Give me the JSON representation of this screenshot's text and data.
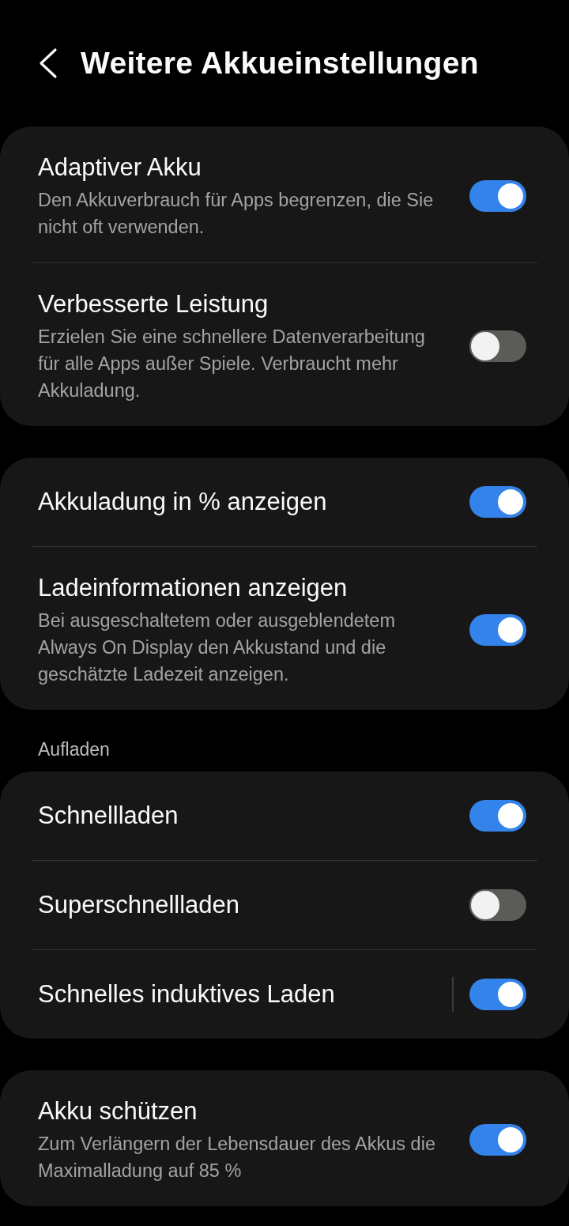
{
  "header": {
    "title": "Weitere Akkueinstellungen"
  },
  "groups": [
    {
      "items": [
        {
          "kind": "switch",
          "title": "Adaptiver Akku",
          "subtitle": "Den Akkuverbrauch für Apps begrenzen, die Sie nicht oft verwenden.",
          "on": true
        },
        {
          "kind": "switch",
          "title": "Verbesserte Leistung",
          "subtitle": "Erzielen Sie eine schnellere Datenverarbeitung für alle Apps außer Spiele. Verbraucht mehr Akkuladung.",
          "on": false
        }
      ]
    },
    {
      "items": [
        {
          "kind": "switch",
          "title": "Akkuladung in % anzeigen",
          "on": true
        },
        {
          "kind": "switch",
          "title": "Ladeinformationen anzeigen",
          "subtitle": "Bei ausgeschaltetem oder ausgeblendetem Always On Display den Akkustand und die geschätzte Ladezeit anzeigen.",
          "on": true
        }
      ]
    },
    {
      "label": "Aufladen",
      "items": [
        {
          "kind": "switch",
          "title": "Schnellladen",
          "on": true
        },
        {
          "kind": "switch",
          "title": "Superschnellladen",
          "on": false
        },
        {
          "kind": "split_switch",
          "title": "Schnelles induktives Laden",
          "on": true
        }
      ]
    },
    {
      "items": [
        {
          "kind": "switch",
          "title": "Akku schützen",
          "subtitle": "Zum Verlängern der Lebensdauer des Akkus die Maximalladung auf 85 %",
          "on": true
        }
      ]
    }
  ]
}
